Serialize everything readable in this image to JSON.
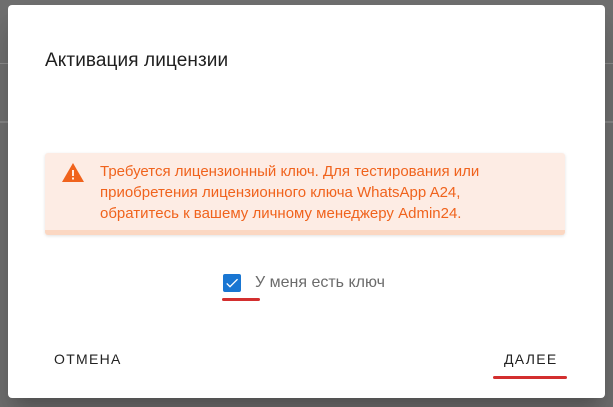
{
  "dialog": {
    "title": "Активация лицензии",
    "alert": {
      "icon": "warning-icon",
      "color": "#f0631d",
      "lines": [
        "Требуется лицензионный ключ. Для тестирования или",
        "приобретения лицензионного ключа WhatsApp A24,",
        "обратитесь к вашему личному менеджеру Admin24."
      ]
    },
    "checkbox": {
      "label": "У меня есть ключ",
      "checked": true,
      "icon": "check-icon"
    },
    "actions": {
      "cancel_label": "ОТМЕНА",
      "next_label": "ДАЛЕЕ"
    },
    "accent_color": "#1976d2",
    "highlight_color": "#d32f2f"
  }
}
